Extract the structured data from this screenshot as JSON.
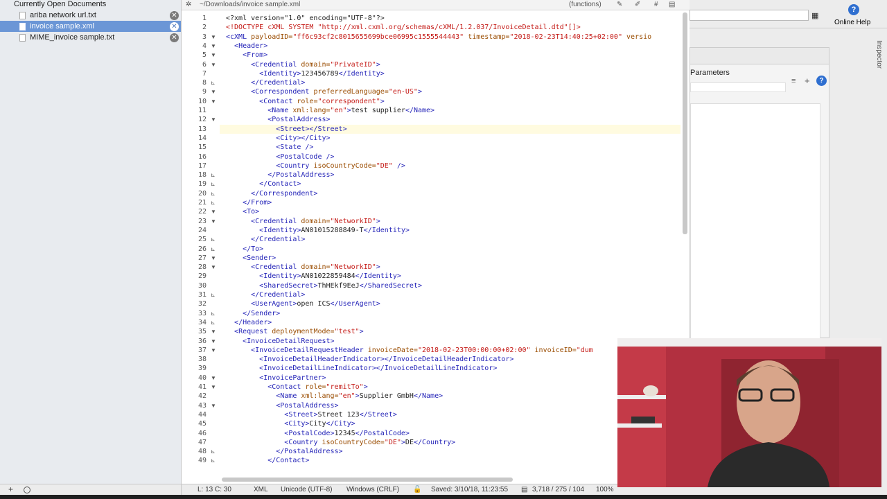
{
  "sidebar": {
    "title": "Currently Open Documents",
    "docs": [
      {
        "name": "ariba network url.txt",
        "close": "✕"
      },
      {
        "name": "invoice sample.xml",
        "close": "✕"
      },
      {
        "name": "MIME_invoice sample.txt",
        "close": "✕"
      }
    ],
    "footer_add": "+",
    "footer_action": "⌚"
  },
  "toolbar": {
    "path": "~/Downloads/invoice sample.xml",
    "functions": "(functions)",
    "gear": "✲"
  },
  "status": {
    "position": "L: 13 C: 30",
    "language": "XML",
    "encoding": "Unicode (UTF-8)",
    "line_endings": "Windows (CRLF)",
    "saved": "Saved: 3/10/18, 11:23:55",
    "stats": "3,718 / 275 / 104",
    "zoom": "100%"
  },
  "right_panel": {
    "online_help": "Online Help",
    "inspector": "Inspector",
    "parameters": "Parameters"
  },
  "code": [
    {
      "n": "1",
      "f": "",
      "c": [
        [
          "p",
          "<?xml version=\"1.0\" encoding=\"UTF-8\"?>"
        ]
      ]
    },
    {
      "n": "2",
      "f": "",
      "c": [
        [
          "s",
          "<!DOCTYPE cXML SYSTEM \"http://xml.cxml.org/schemas/cXML/1.2.037/InvoiceDetail.dtd\"[]>"
        ]
      ]
    },
    {
      "n": "3",
      "f": "▼",
      "c": [
        [
          "t",
          "<cXML "
        ],
        [
          "a",
          "payloadID="
        ],
        [
          "s",
          "\"ff6c93cf2c8015655699bce06995c1555544443\""
        ],
        [
          "a",
          " timestamp="
        ],
        [
          "s",
          "\"2018-02-23T14:40:25+02:00\""
        ],
        [
          "a",
          " versio"
        ]
      ]
    },
    {
      "n": "4",
      "f": "▼",
      "c": [
        [
          "p",
          "  "
        ],
        [
          "t",
          "<Header>"
        ]
      ]
    },
    {
      "n": "5",
      "f": "▼",
      "c": [
        [
          "p",
          "    "
        ],
        [
          "t",
          "<From>"
        ]
      ]
    },
    {
      "n": "6",
      "f": "▼",
      "c": [
        [
          "p",
          "      "
        ],
        [
          "t",
          "<Credential "
        ],
        [
          "a",
          "domain="
        ],
        [
          "s",
          "\"PrivateID\""
        ],
        [
          "t",
          ">"
        ]
      ]
    },
    {
      "n": "7",
      "f": "",
      "c": [
        [
          "p",
          "        "
        ],
        [
          "t",
          "<Identity>"
        ],
        [
          "p",
          "123456789"
        ],
        [
          "t",
          "</Identity>"
        ]
      ]
    },
    {
      "n": "8",
      "f": "⊾",
      "c": [
        [
          "p",
          "      "
        ],
        [
          "t",
          "</Credential>"
        ]
      ]
    },
    {
      "n": "9",
      "f": "▼",
      "c": [
        [
          "p",
          "      "
        ],
        [
          "t",
          "<Correspondent "
        ],
        [
          "a",
          "preferredLanguage="
        ],
        [
          "s",
          "\"en-US\""
        ],
        [
          "t",
          ">"
        ]
      ]
    },
    {
      "n": "10",
      "f": "▼",
      "c": [
        [
          "p",
          "        "
        ],
        [
          "t",
          "<Contact "
        ],
        [
          "a",
          "role="
        ],
        [
          "s",
          "\"correspondent\""
        ],
        [
          "t",
          ">"
        ]
      ]
    },
    {
      "n": "11",
      "f": "",
      "c": [
        [
          "p",
          "          "
        ],
        [
          "t",
          "<Name "
        ],
        [
          "a",
          "xml:lang="
        ],
        [
          "s",
          "\"en\""
        ],
        [
          "t",
          ">"
        ],
        [
          "p",
          "test supplier"
        ],
        [
          "t",
          "</Name>"
        ]
      ]
    },
    {
      "n": "12",
      "f": "▼",
      "c": [
        [
          "p",
          "          "
        ],
        [
          "t",
          "<PostalAddress>"
        ]
      ]
    },
    {
      "n": "13",
      "f": "",
      "c": [
        [
          "p",
          "            "
        ],
        [
          "t",
          "<Street></Street>"
        ]
      ],
      "cur": true
    },
    {
      "n": "14",
      "f": "",
      "c": [
        [
          "p",
          "            "
        ],
        [
          "t",
          "<City></City>"
        ]
      ]
    },
    {
      "n": "15",
      "f": "",
      "c": [
        [
          "p",
          "            "
        ],
        [
          "t",
          "<State />"
        ]
      ]
    },
    {
      "n": "16",
      "f": "",
      "c": [
        [
          "p",
          "            "
        ],
        [
          "t",
          "<PostalCode />"
        ]
      ]
    },
    {
      "n": "17",
      "f": "",
      "c": [
        [
          "p",
          "            "
        ],
        [
          "t",
          "<Country "
        ],
        [
          "a",
          "isoCountryCode="
        ],
        [
          "s",
          "\"DE\""
        ],
        [
          "t",
          " />"
        ]
      ]
    },
    {
      "n": "18",
      "f": "⊾",
      "c": [
        [
          "p",
          "          "
        ],
        [
          "t",
          "</PostalAddress>"
        ]
      ]
    },
    {
      "n": "19",
      "f": "⊾",
      "c": [
        [
          "p",
          "        "
        ],
        [
          "t",
          "</Contact>"
        ]
      ]
    },
    {
      "n": "20",
      "f": "⊾",
      "c": [
        [
          "p",
          "      "
        ],
        [
          "t",
          "</Correspondent>"
        ]
      ]
    },
    {
      "n": "21",
      "f": "⊾",
      "c": [
        [
          "p",
          "    "
        ],
        [
          "t",
          "</From>"
        ]
      ]
    },
    {
      "n": "22",
      "f": "▼",
      "c": [
        [
          "p",
          "    "
        ],
        [
          "t",
          "<To>"
        ]
      ]
    },
    {
      "n": "23",
      "f": "▼",
      "c": [
        [
          "p",
          "      "
        ],
        [
          "t",
          "<Credential "
        ],
        [
          "a",
          "domain="
        ],
        [
          "s",
          "\"NetworkID\""
        ],
        [
          "t",
          ">"
        ]
      ]
    },
    {
      "n": "24",
      "f": "",
      "c": [
        [
          "p",
          "        "
        ],
        [
          "t",
          "<Identity>"
        ],
        [
          "p",
          "AN01015288849-T"
        ],
        [
          "t",
          "</Identity>"
        ]
      ]
    },
    {
      "n": "25",
      "f": "⊾",
      "c": [
        [
          "p",
          "      "
        ],
        [
          "t",
          "</Credential>"
        ]
      ]
    },
    {
      "n": "26",
      "f": "⊾",
      "c": [
        [
          "p",
          "    "
        ],
        [
          "t",
          "</To>"
        ]
      ]
    },
    {
      "n": "27",
      "f": "▼",
      "c": [
        [
          "p",
          "    "
        ],
        [
          "t",
          "<Sender>"
        ]
      ]
    },
    {
      "n": "28",
      "f": "▼",
      "c": [
        [
          "p",
          "      "
        ],
        [
          "t",
          "<Credential "
        ],
        [
          "a",
          "domain="
        ],
        [
          "s",
          "\"NetworkID\""
        ],
        [
          "t",
          ">"
        ]
      ]
    },
    {
      "n": "29",
      "f": "",
      "c": [
        [
          "p",
          "        "
        ],
        [
          "t",
          "<Identity>"
        ],
        [
          "p",
          "AN01022859484"
        ],
        [
          "t",
          "</Identity>"
        ]
      ]
    },
    {
      "n": "30",
      "f": "",
      "c": [
        [
          "p",
          "        "
        ],
        [
          "t",
          "<SharedSecret>"
        ],
        [
          "p",
          "ThHEkf9EeJ"
        ],
        [
          "t",
          "</SharedSecret>"
        ]
      ]
    },
    {
      "n": "31",
      "f": "⊾",
      "c": [
        [
          "p",
          "      "
        ],
        [
          "t",
          "</Credential>"
        ]
      ]
    },
    {
      "n": "32",
      "f": "",
      "c": [
        [
          "p",
          "      "
        ],
        [
          "t",
          "<UserAgent>"
        ],
        [
          "p",
          "open ICS"
        ],
        [
          "t",
          "</UserAgent>"
        ]
      ]
    },
    {
      "n": "33",
      "f": "⊾",
      "c": [
        [
          "p",
          "    "
        ],
        [
          "t",
          "</Sender>"
        ]
      ]
    },
    {
      "n": "34",
      "f": "⊾",
      "c": [
        [
          "p",
          "  "
        ],
        [
          "t",
          "</Header>"
        ]
      ]
    },
    {
      "n": "35",
      "f": "▼",
      "c": [
        [
          "p",
          "  "
        ],
        [
          "t",
          "<Request "
        ],
        [
          "a",
          "deploymentMode="
        ],
        [
          "s",
          "\"test\""
        ],
        [
          "t",
          ">"
        ]
      ]
    },
    {
      "n": "36",
      "f": "▼",
      "c": [
        [
          "p",
          "    "
        ],
        [
          "t",
          "<InvoiceDetailRequest>"
        ]
      ]
    },
    {
      "n": "37",
      "f": "▼",
      "c": [
        [
          "p",
          "      "
        ],
        [
          "t",
          "<InvoiceDetailRequestHeader "
        ],
        [
          "a",
          "invoiceDate="
        ],
        [
          "s",
          "\"2018-02-23T00:00:00+02:00\""
        ],
        [
          "a",
          " invoiceID="
        ],
        [
          "s",
          "\"dum"
        ]
      ]
    },
    {
      "n": "38",
      "f": "",
      "c": [
        [
          "p",
          "        "
        ],
        [
          "t",
          "<InvoiceDetailHeaderIndicator></InvoiceDetailHeaderIndicator>"
        ]
      ]
    },
    {
      "n": "39",
      "f": "",
      "c": [
        [
          "p",
          "        "
        ],
        [
          "t",
          "<InvoiceDetailLineIndicator></InvoiceDetailLineIndicator>"
        ]
      ]
    },
    {
      "n": "40",
      "f": "▼",
      "c": [
        [
          "p",
          "        "
        ],
        [
          "t",
          "<InvoicePartner>"
        ]
      ]
    },
    {
      "n": "41",
      "f": "▼",
      "c": [
        [
          "p",
          "          "
        ],
        [
          "t",
          "<Contact "
        ],
        [
          "a",
          "role="
        ],
        [
          "s",
          "\"remitTo\""
        ],
        [
          "t",
          ">"
        ]
      ]
    },
    {
      "n": "42",
      "f": "",
      "c": [
        [
          "p",
          "            "
        ],
        [
          "t",
          "<Name "
        ],
        [
          "a",
          "xml:lang="
        ],
        [
          "s",
          "\"en\""
        ],
        [
          "t",
          ">"
        ],
        [
          "p",
          "Supplier GmbH"
        ],
        [
          "t",
          "</Name>"
        ]
      ]
    },
    {
      "n": "43",
      "f": "▼",
      "c": [
        [
          "p",
          "            "
        ],
        [
          "t",
          "<PostalAddress>"
        ]
      ]
    },
    {
      "n": "44",
      "f": "",
      "c": [
        [
          "p",
          "              "
        ],
        [
          "t",
          "<Street>"
        ],
        [
          "p",
          "Street 123"
        ],
        [
          "t",
          "</Street>"
        ]
      ]
    },
    {
      "n": "45",
      "f": "",
      "c": [
        [
          "p",
          "              "
        ],
        [
          "t",
          "<City>"
        ],
        [
          "p",
          "City"
        ],
        [
          "t",
          "</City>"
        ]
      ]
    },
    {
      "n": "46",
      "f": "",
      "c": [
        [
          "p",
          "              "
        ],
        [
          "t",
          "<PostalCode>"
        ],
        [
          "p",
          "12345"
        ],
        [
          "t",
          "</PostalCode>"
        ]
      ]
    },
    {
      "n": "47",
      "f": "",
      "c": [
        [
          "p",
          "              "
        ],
        [
          "t",
          "<Country "
        ],
        [
          "a",
          "isoCountryCode="
        ],
        [
          "s",
          "\"DE\""
        ],
        [
          "t",
          ">"
        ],
        [
          "p",
          "DE"
        ],
        [
          "t",
          "</Country>"
        ]
      ]
    },
    {
      "n": "48",
      "f": "⊾",
      "c": [
        [
          "p",
          "            "
        ],
        [
          "t",
          "</PostalAddress>"
        ]
      ]
    },
    {
      "n": "49",
      "f": "⊾",
      "c": [
        [
          "p",
          "          "
        ],
        [
          "t",
          "</Contact>"
        ]
      ]
    }
  ]
}
